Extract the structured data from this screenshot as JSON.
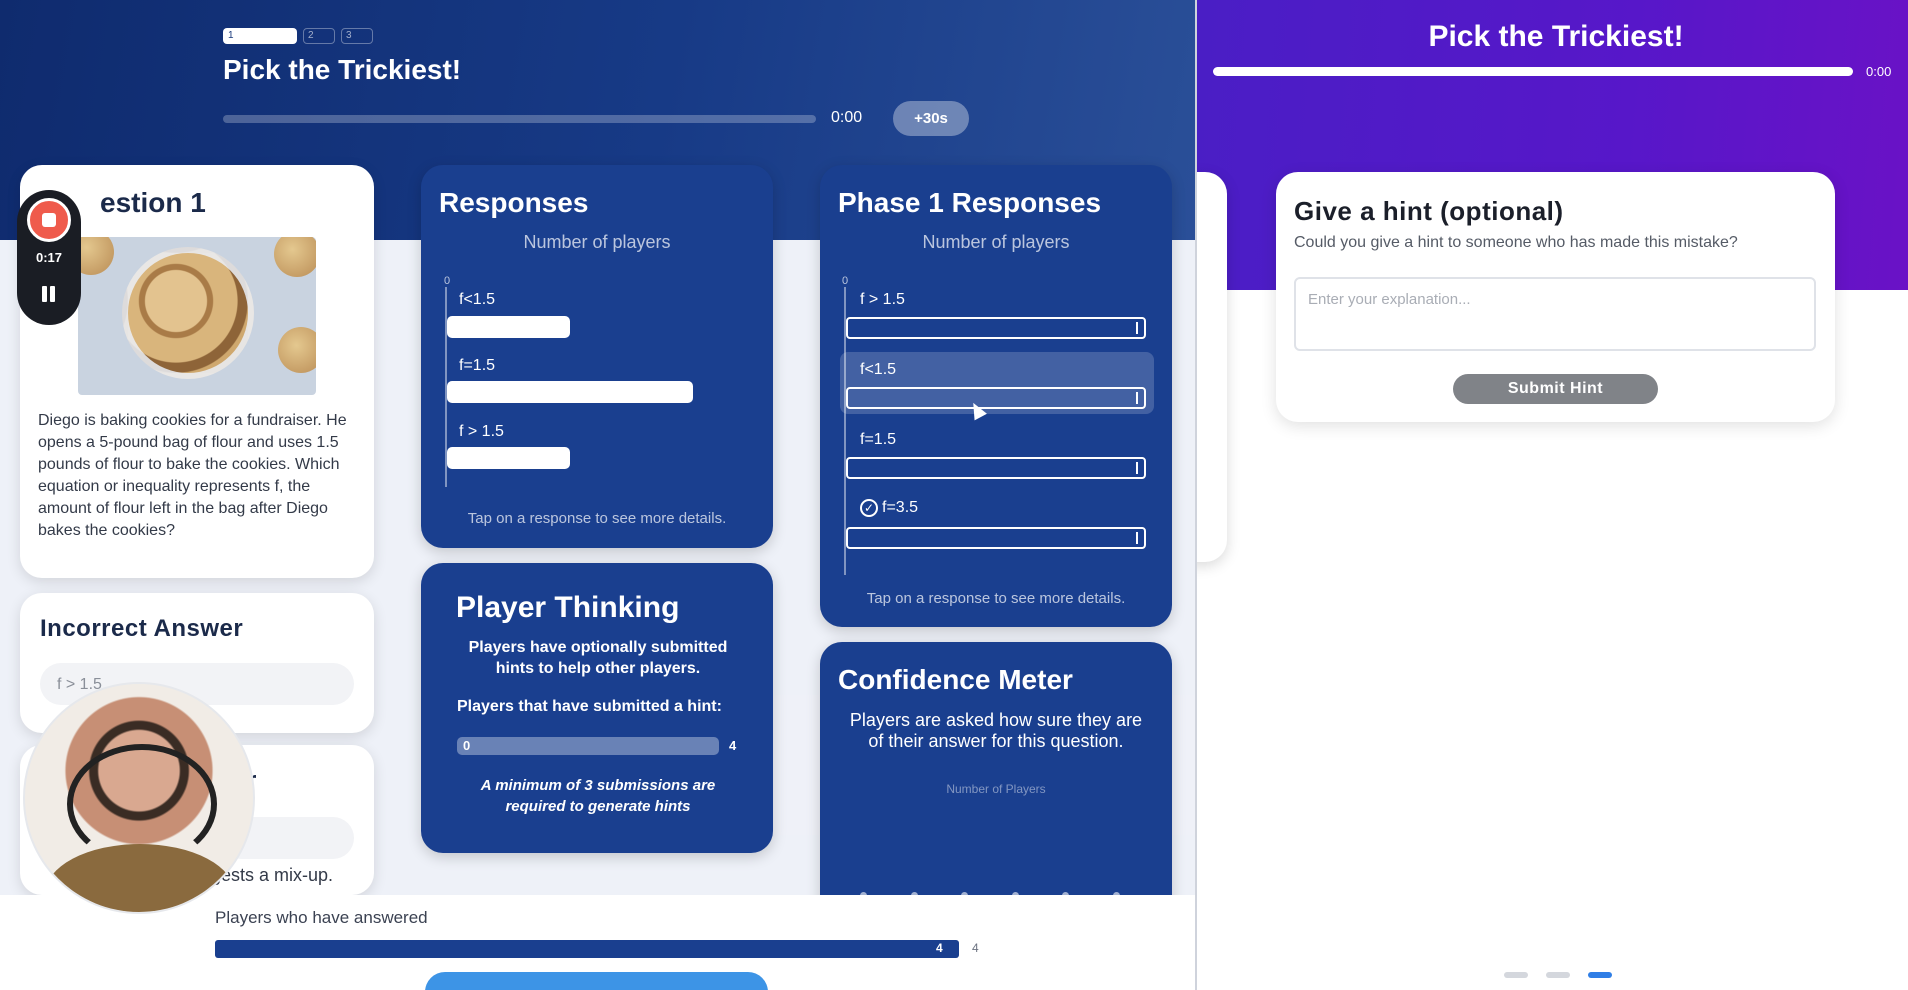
{
  "teacher": {
    "steps": [
      "1",
      "2",
      "3"
    ],
    "title": "Pick the Trickiest!",
    "timer": "0:00",
    "add_time_label": "+30s",
    "question_card": {
      "title": "estion 1",
      "text": "Diego is baking cookies for a fundraiser. He opens a 5-pound bag of flour and uses 1.5 pounds of flour to bake the cookies. Which equation or inequality represents f, the amount of flour left in the bag after Diego bakes the cookies?"
    },
    "incorrect_answer": {
      "title": "Incorrect Answer",
      "value": "f > 1.5"
    },
    "third_card": {
      "title_fragment": "r",
      "text_fragment": "gests a mix-up."
    },
    "responses": {
      "title": "Responses",
      "subtitle": "Number of players",
      "axis_zero": "0",
      "items": [
        {
          "label": "f<1.5",
          "count": 1
        },
        {
          "label": "f=1.5",
          "count": 2
        },
        {
          "label": "f > 1.5",
          "count": 1
        }
      ],
      "max": 2,
      "footer": "Tap on a response to see more details."
    },
    "phase1": {
      "title": "Phase 1 Responses",
      "subtitle": "Number of players",
      "axis_zero": "0",
      "items": [
        {
          "label": "f > 1.5",
          "correct": false
        },
        {
          "label": "f<1.5",
          "correct": false
        },
        {
          "label": "f=1.5",
          "correct": false
        },
        {
          "label": "f=3.5",
          "correct": true
        }
      ],
      "footer": "Tap on a response to see more details."
    },
    "player_thinking": {
      "title": "Player Thinking",
      "description": "Players have optionally submitted hints to help other players.",
      "subtitle": "Players that have submitted a hint:",
      "min_label": "0",
      "max_label": "4",
      "note": "A minimum of 3 submissions are required to generate hints"
    },
    "confidence": {
      "title": "Confidence Meter",
      "description": "Players are asked how sure they are of their answer for this question.",
      "subtitle": "Number of Players"
    },
    "answered": {
      "label": "Players who have answered",
      "count": "4",
      "total": "4",
      "progress": 1.0
    },
    "recording": {
      "time": "0:17"
    }
  },
  "student": {
    "title": "Pick the Trickiest!",
    "timer": "0:00",
    "hint_card": {
      "title": "Give a hint (optional)",
      "subtitle": "Could you give a hint to someone who has made this mistake?",
      "placeholder": "Enter your explanation...",
      "submit_label": "Submit Hint"
    },
    "pager_active_index": 2
  },
  "colors": {
    "teacher_header": "#173a86",
    "card_blue": "#1a3f8f",
    "student_header": "#5717c9",
    "record_red": "#ef5b4c",
    "pager_active": "#2f7ee6"
  },
  "icons": [
    "stop-icon",
    "pause-icon",
    "check-circle-icon",
    "cursor-icon"
  ]
}
